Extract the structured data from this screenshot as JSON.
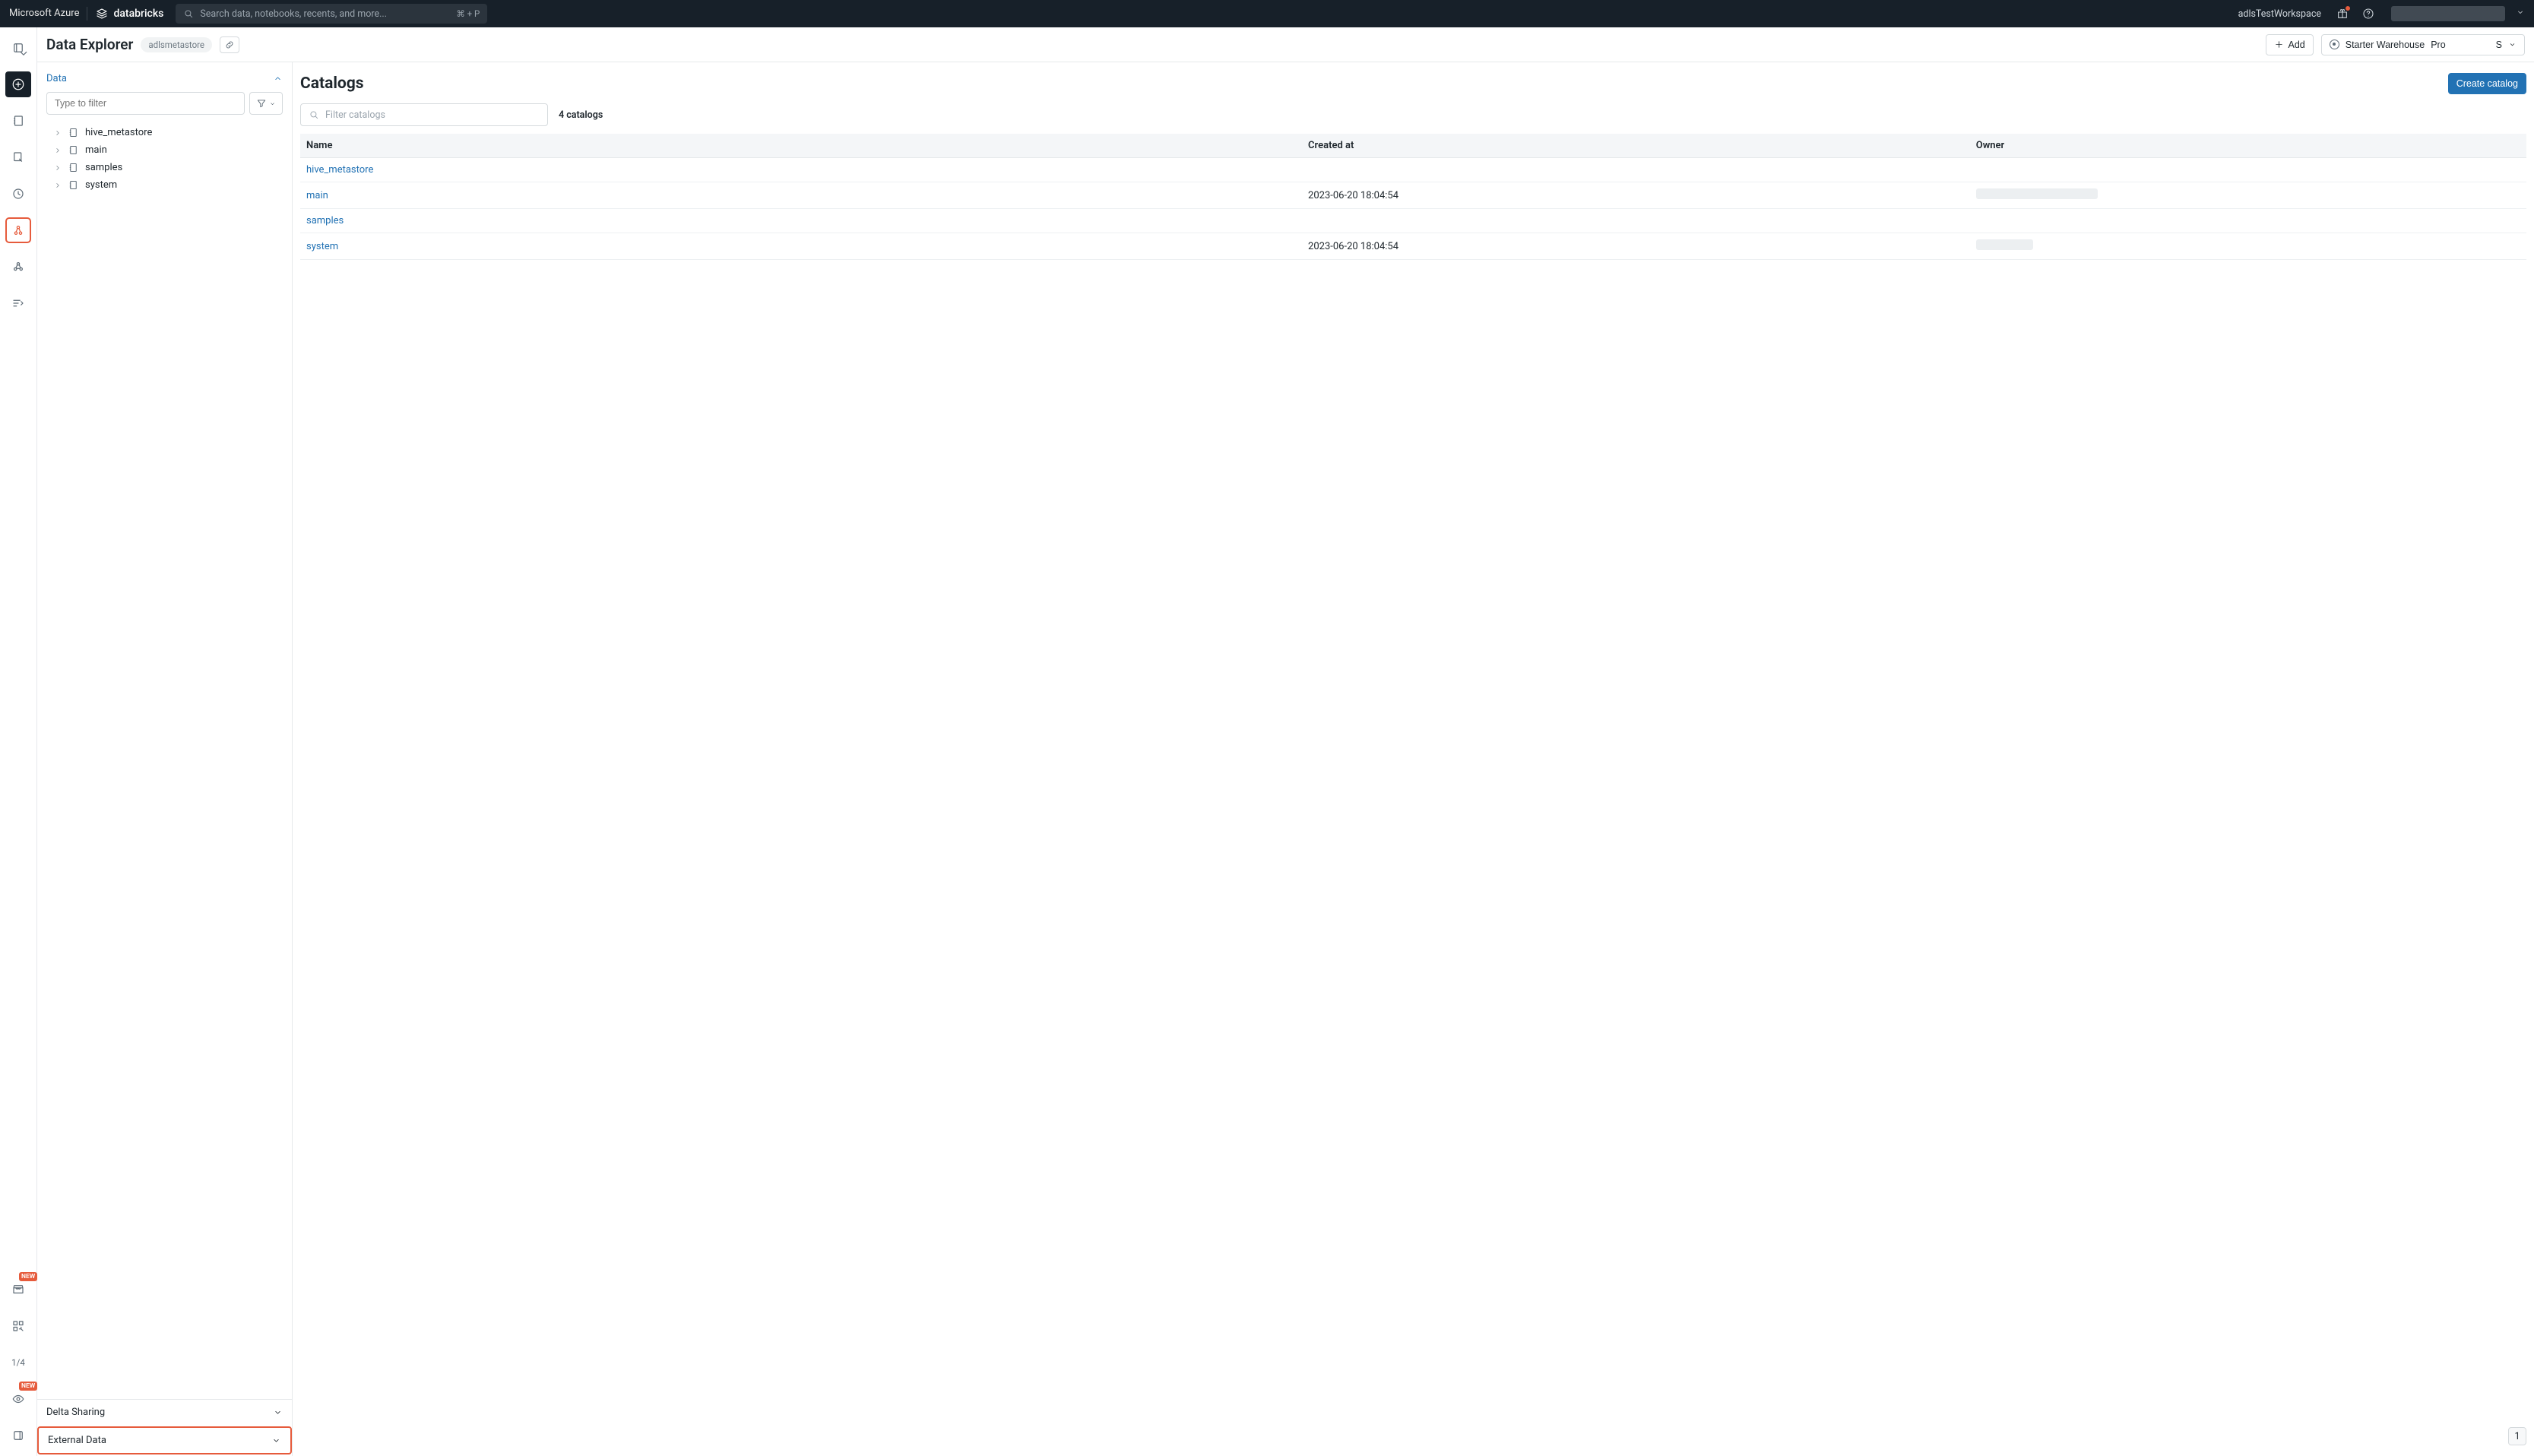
{
  "topbar": {
    "brand": "Microsoft Azure",
    "logo_text": "databricks",
    "search_placeholder": "Search data, notebooks, recents, and more...",
    "shortcut": "⌘ + P",
    "workspace": "adlsTestWorkspace"
  },
  "leftrail": {
    "text_item": "1/4"
  },
  "header": {
    "title": "Data Explorer",
    "tag": "adlsmetastore",
    "add_label": "Add",
    "warehouse_name": "Starter Warehouse",
    "warehouse_tier": "Pro",
    "warehouse_size": "S"
  },
  "sidebar": {
    "section_data": "Data",
    "filter_placeholder": "Type to filter",
    "items": [
      {
        "label": "hive_metastore"
      },
      {
        "label": "main"
      },
      {
        "label": "samples"
      },
      {
        "label": "system"
      }
    ],
    "delta_sharing": "Delta Sharing",
    "external_data": "External Data"
  },
  "content": {
    "title": "Catalogs",
    "create_btn": "Create catalog",
    "filter_placeholder": "Filter catalogs",
    "count_label": "4 catalogs",
    "columns": {
      "name": "Name",
      "created": "Created at",
      "owner": "Owner"
    },
    "rows": [
      {
        "name": "hive_metastore",
        "created": "",
        "owner_redact": 0
      },
      {
        "name": "main",
        "created": "2023-06-20 18:04:54",
        "owner_redact": 160
      },
      {
        "name": "samples",
        "created": "",
        "owner_redact": 0
      },
      {
        "name": "system",
        "created": "2023-06-20 18:04:54",
        "owner_redact": 75
      }
    ],
    "page": "1"
  },
  "rail_badge": "NEW"
}
